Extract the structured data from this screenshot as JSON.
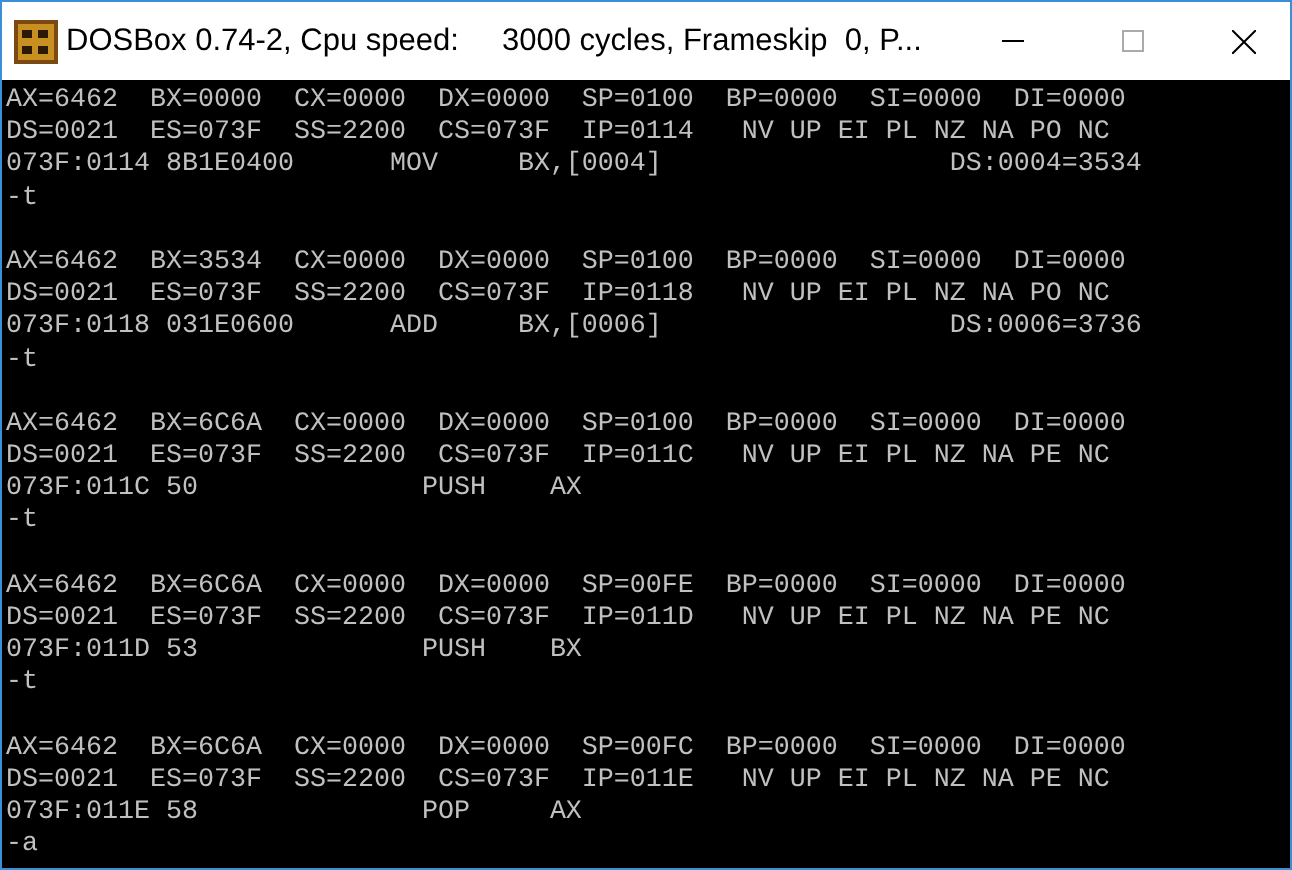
{
  "window": {
    "title": "DOSBox 0.74-2, Cpu speed:     3000 cycles, Frameskip  0, P..."
  },
  "console": {
    "blocks": [
      {
        "registers": "AX=6462  BX=0000  CX=0000  DX=0000  SP=0100  BP=0000  SI=0000  DI=0000",
        "segments": "DS=0021  ES=073F  SS=2200  CS=073F  IP=0114   NV UP EI PL NZ NA PO NC",
        "instruction": "073F:0114 8B1E0400      MOV     BX,[0004]                  DS:0004=3534",
        "command": "-t"
      },
      {
        "registers": "AX=6462  BX=3534  CX=0000  DX=0000  SP=0100  BP=0000  SI=0000  DI=0000",
        "segments": "DS=0021  ES=073F  SS=2200  CS=073F  IP=0118   NV UP EI PL NZ NA PO NC",
        "instruction": "073F:0118 031E0600      ADD     BX,[0006]                  DS:0006=3736",
        "command": "-t"
      },
      {
        "registers": "AX=6462  BX=6C6A  CX=0000  DX=0000  SP=0100  BP=0000  SI=0000  DI=0000",
        "segments": "DS=0021  ES=073F  SS=2200  CS=073F  IP=011C   NV UP EI PL NZ NA PE NC",
        "instruction": "073F:011C 50              PUSH    AX",
        "command": "-t"
      },
      {
        "registers": "AX=6462  BX=6C6A  CX=0000  DX=0000  SP=00FE  BP=0000  SI=0000  DI=0000",
        "segments": "DS=0021  ES=073F  SS=2200  CS=073F  IP=011D   NV UP EI PL NZ NA PE NC",
        "instruction": "073F:011D 53              PUSH    BX",
        "command": "-t"
      },
      {
        "registers": "AX=6462  BX=6C6A  CX=0000  DX=0000  SP=00FC  BP=0000  SI=0000  DI=0000",
        "segments": "DS=0021  ES=073F  SS=2200  CS=073F  IP=011E   NV UP EI PL NZ NA PE NC",
        "instruction": "073F:011E 58              POP     AX",
        "command": "-a"
      }
    ]
  }
}
